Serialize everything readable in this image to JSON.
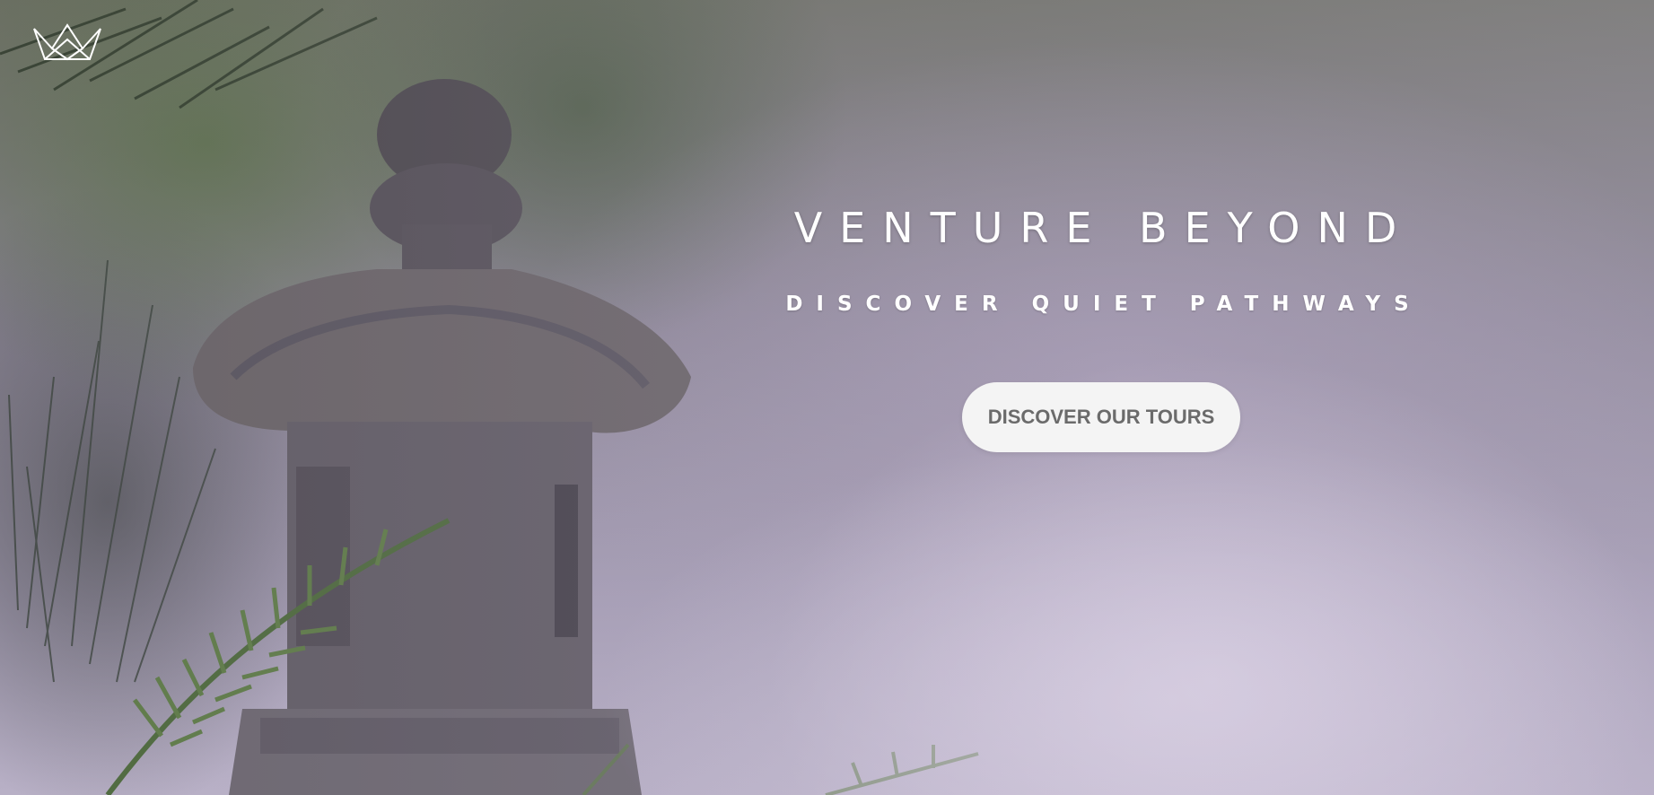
{
  "brand": {
    "logo_icon": "crown-icon"
  },
  "hero": {
    "headline": "VENTURE BEYOND",
    "subhead": "DISCOVER QUIET PATHWAYS",
    "cta_label": "DISCOVER OUR TOURS",
    "text_color": "#ffffff",
    "cta_background": "#f4f4f4",
    "cta_text_color": "#6b6b6b"
  }
}
